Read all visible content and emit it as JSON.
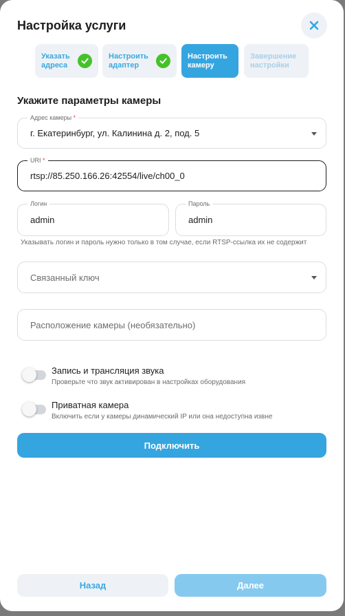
{
  "header": {
    "title": "Настройка услуги"
  },
  "steps": [
    {
      "label": "Указать адреса",
      "state": "done"
    },
    {
      "label": "Настроить адаптер",
      "state": "done"
    },
    {
      "label": "Настроить камеру",
      "state": "active"
    },
    {
      "label": "Завершение настройки",
      "state": "future"
    }
  ],
  "form": {
    "section_title": "Укажите параметры камеры",
    "address": {
      "label": "Адрес камеры",
      "required": "*",
      "value": "г. Екатеринбург, ул. Калинина д. 2, под. 5"
    },
    "uri": {
      "label": "URI",
      "required": "*",
      "value": "rtsp://85.250.166.26:42554/live/ch00_0"
    },
    "login": {
      "label": "Логин",
      "value": "admin"
    },
    "password": {
      "label": "Пароль",
      "value": "admin"
    },
    "credentials_hint": "Указывать логин и пароль нужно только в том случае, если RTSP-ссылка их не содержит",
    "linked_key": {
      "placeholder": "Связанный ключ"
    },
    "location": {
      "placeholder": "Расположение камеры (необязательно)"
    }
  },
  "toggles": [
    {
      "label": "Запись и трансляция звука",
      "description": "Проверьте что звук активирован в настройках оборудования",
      "enabled": false
    },
    {
      "label": "Приватная камера",
      "description": "Включить если у камеры динамический IP или она недоступна извне",
      "enabled": false
    }
  ],
  "actions": {
    "connect": "Подключить",
    "back": "Назад",
    "next": "Далее"
  },
  "colors": {
    "accent": "#35a5e0",
    "success": "#45c22a",
    "required": "#e04444",
    "muted_bg": "#eef2f6"
  },
  "icons": {
    "close": "close-icon",
    "check": "check-icon",
    "dropdown": "chevron-down-icon"
  }
}
